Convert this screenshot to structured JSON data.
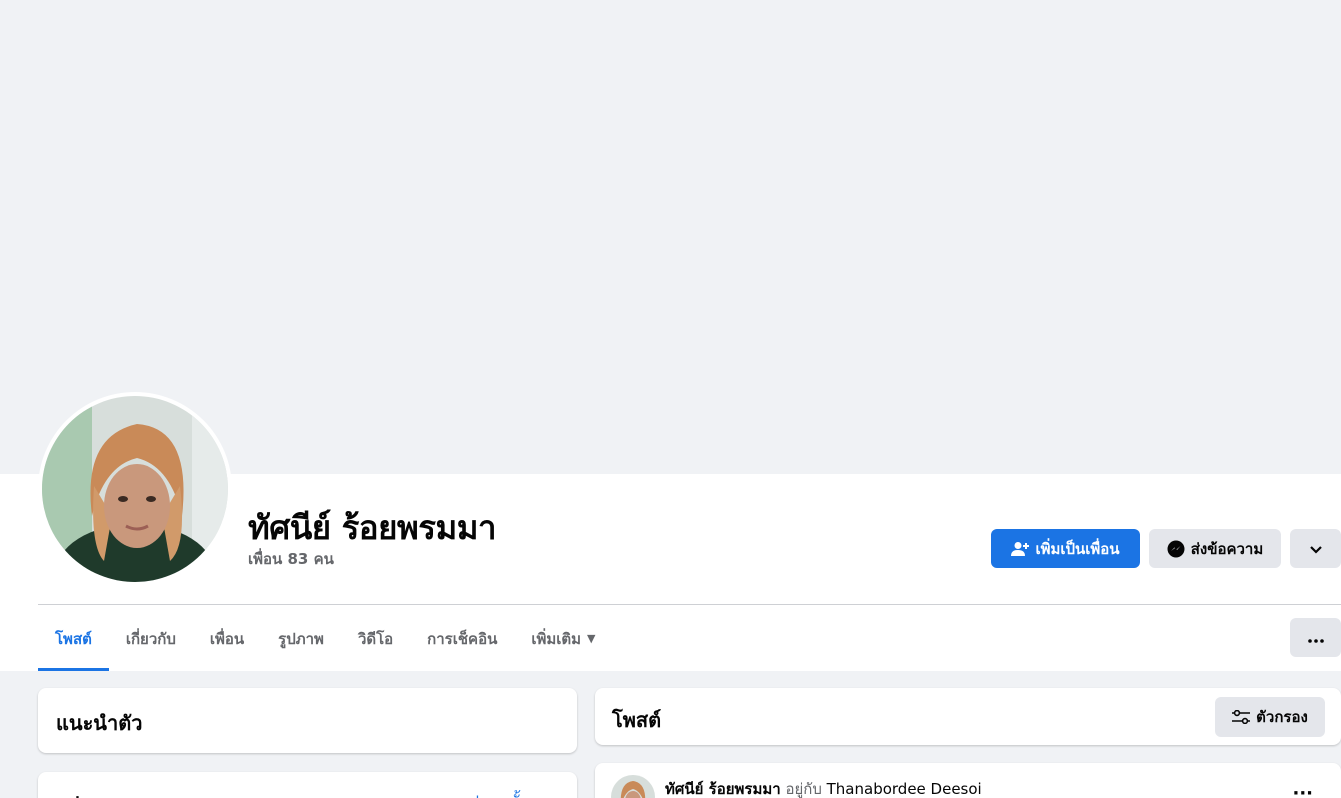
{
  "profile": {
    "name": "ทัศนีย์ ร้อยพรมมา",
    "friends_count": "เพื่อน 83 คน"
  },
  "actions": {
    "add_friend": "เพิ่มเป็นเพื่อน",
    "message": "ส่งข้อความ"
  },
  "tabs": [
    {
      "label": "โพสต์",
      "active": true
    },
    {
      "label": "เกี่ยวกับ"
    },
    {
      "label": "เพื่อน"
    },
    {
      "label": "รูปภาพ"
    },
    {
      "label": "วิดีโอ"
    },
    {
      "label": "การเช็คอิน"
    },
    {
      "label": "เพิ่มเติม"
    }
  ],
  "intro": {
    "title": "แนะนำตัว"
  },
  "photos": {
    "title": "รูปภาพ",
    "link": "ดูรูปภาพทั้งหมด"
  },
  "posts": {
    "title": "โพสต์",
    "filter": "ตัวกรอง"
  },
  "post": {
    "author": "ทัศนีย์ ร้อยพรมมา",
    "with_text": "อยู่กับ",
    "tagged": "Thanabordee Deesoi"
  },
  "colors": {
    "accent": "#1b74e4",
    "background": "#f0f2f5",
    "secondary_button": "#e4e6eb"
  },
  "icons": {
    "add_friend": "person-add-icon",
    "message": "messenger-icon",
    "chevron": "chevron-down-icon",
    "more": "more-dots-icon",
    "filter": "filter-sliders-icon"
  }
}
